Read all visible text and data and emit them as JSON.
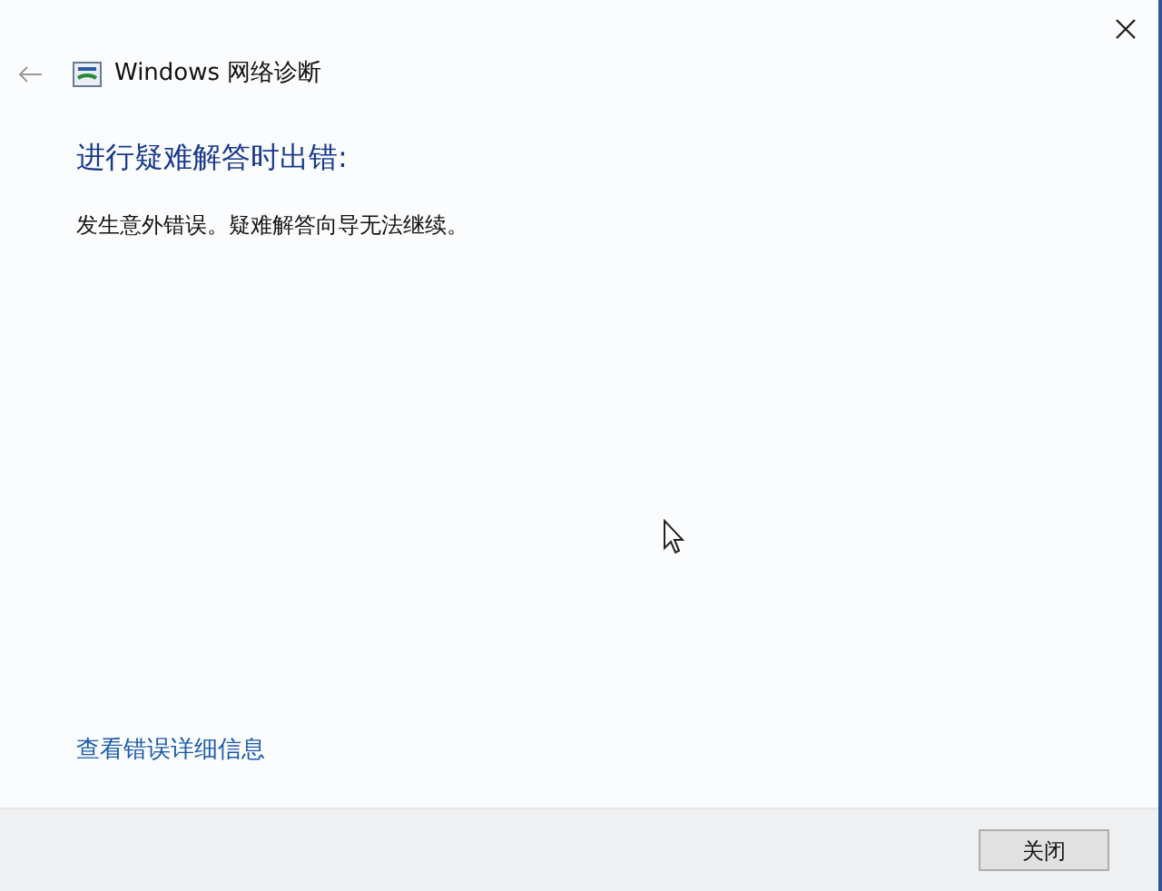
{
  "window": {
    "title": "Windows 网络诊断"
  },
  "heading": "进行疑难解答时出错:",
  "message": "发生意外错误。疑难解答向导无法继续。",
  "details_link": "查看错误详细信息",
  "buttons": [
    "关闭"
  ]
}
